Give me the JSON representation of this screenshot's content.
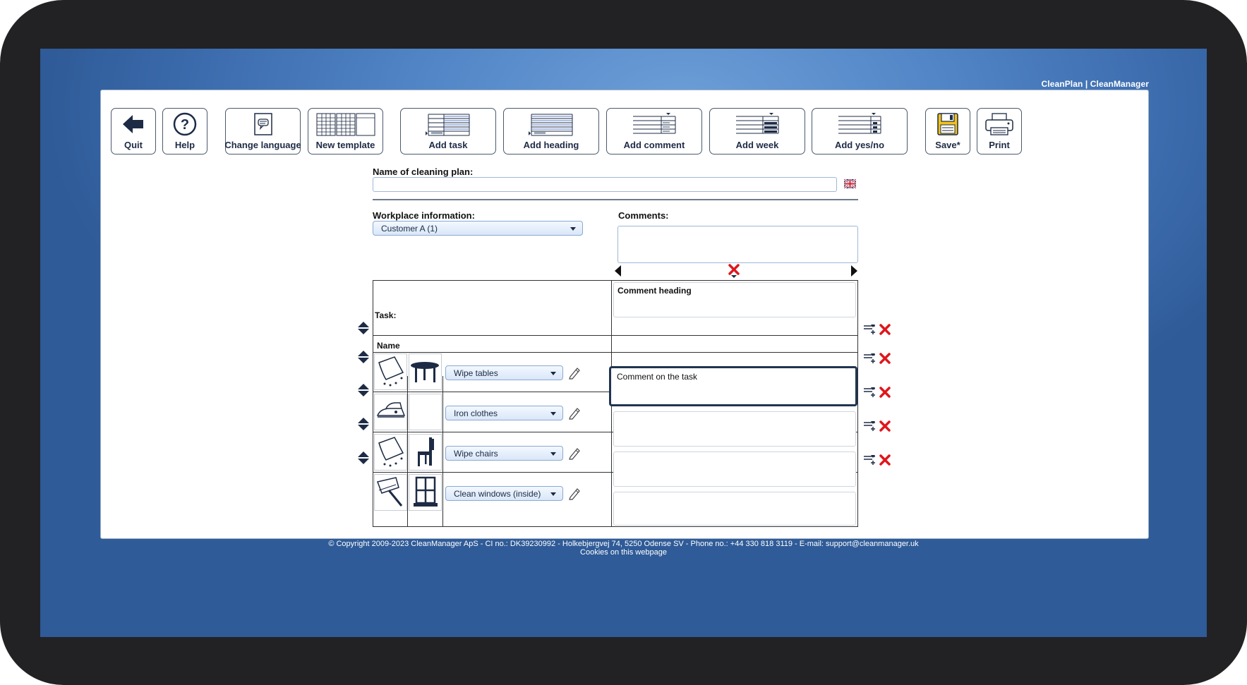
{
  "brand": "CleanPlan | CleanManager",
  "toolbar": {
    "quit": "Quit",
    "help": "Help",
    "change_language": "Change language",
    "new_template": "New template",
    "add_task": "Add task",
    "add_heading": "Add heading",
    "add_comment": "Add comment",
    "add_week": "Add week",
    "add_yes_no": "Add yes/no",
    "save": "Save*",
    "print": "Print"
  },
  "form": {
    "name_label": "Name of cleaning plan:",
    "name_value": "",
    "workplace_label": "Workplace information:",
    "workplace_value": "Customer A (1)",
    "comments_label": "Comments:",
    "comments_value": ""
  },
  "grid": {
    "task_label": "Task:",
    "comment_heading": "Comment heading",
    "name_header": "Name",
    "rows": [
      {
        "task": "Wipe tables",
        "comment": "Comment on the task"
      },
      {
        "task": "Iron clothes",
        "comment": ""
      },
      {
        "task": "Wipe chairs",
        "comment": ""
      },
      {
        "task": "Clean windows (inside)",
        "comment": ""
      }
    ]
  },
  "footer": {
    "copyright": "© Copyright 2009-2023 CleanManager ApS - CI no.: DK39230992 - Holkebjergvej 74, 5250 Odense SV - Phone no.: +44 330 818 3119 - E-mail: support@cleanmanager.uk",
    "cookies": "Cookies on this webpage"
  },
  "colors": {
    "background_blue": "#4f83c4",
    "accent_dark": "#1d2b45",
    "delete_red": "#e0161b",
    "save_yellow": "#f2c318"
  }
}
